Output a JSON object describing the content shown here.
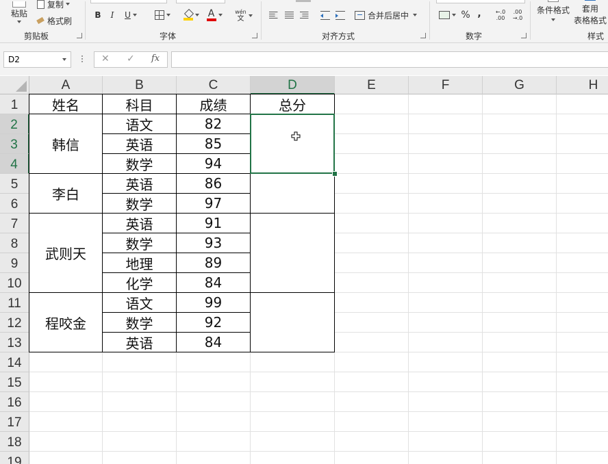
{
  "ribbon": {
    "paste": "粘贴",
    "copy": "复制",
    "format_painter": "格式刷",
    "clipboard_group": "剪贴板",
    "font_group": "字体",
    "bold": "B",
    "italic": "I",
    "underline": "U",
    "font_color_letter": "A",
    "phonetic_top": "wén",
    "phonetic_bottom": "文",
    "align_group": "对齐方式",
    "merge_center": "合并后居中",
    "number_group": "数字",
    "percent": "%",
    "comma": ",",
    "dec_inc": "←.0 .00",
    "dec_dec": ".00 →.0",
    "conditional_format": "条件格式",
    "table_format_1": "套用",
    "table_format_2": "表格格式",
    "styles_group": "样式",
    "fill_color": "#ffd200",
    "font_color": "#e00000"
  },
  "formula_bar": {
    "name_box": "D2",
    "cancel": "✕",
    "enter": "✓",
    "fx": "fx",
    "formula": ""
  },
  "sheet": {
    "columns": [
      "A",
      "B",
      "C",
      "D",
      "E",
      "F",
      "G",
      "H"
    ],
    "rows": [
      "1",
      "2",
      "3",
      "4",
      "5",
      "6",
      "7",
      "8",
      "9",
      "10",
      "11",
      "12",
      "13",
      "14",
      "15",
      "16",
      "17",
      "18",
      "19"
    ],
    "header": {
      "name": "姓名",
      "subject": "科目",
      "score": "成绩",
      "total": "总分"
    },
    "students": [
      {
        "name": "韩信",
        "records": [
          {
            "subject": "语文",
            "score": "82"
          },
          {
            "subject": "英语",
            "score": "85"
          },
          {
            "subject": "数学",
            "score": "94"
          }
        ]
      },
      {
        "name": "李白",
        "records": [
          {
            "subject": "英语",
            "score": "86"
          },
          {
            "subject": "数学",
            "score": "97"
          }
        ]
      },
      {
        "name": "武则天",
        "records": [
          {
            "subject": "英语",
            "score": "91"
          },
          {
            "subject": "数学",
            "score": "93"
          },
          {
            "subject": "地理",
            "score": "89"
          },
          {
            "subject": "化学",
            "score": "84"
          }
        ]
      },
      {
        "name": "程咬金",
        "records": [
          {
            "subject": "语文",
            "score": "99"
          },
          {
            "subject": "数学",
            "score": "92"
          },
          {
            "subject": "英语",
            "score": "84"
          }
        ]
      }
    ],
    "selected_column": "D",
    "selected_rows": [
      "2",
      "3",
      "4"
    ],
    "accent_color": "#217346"
  }
}
